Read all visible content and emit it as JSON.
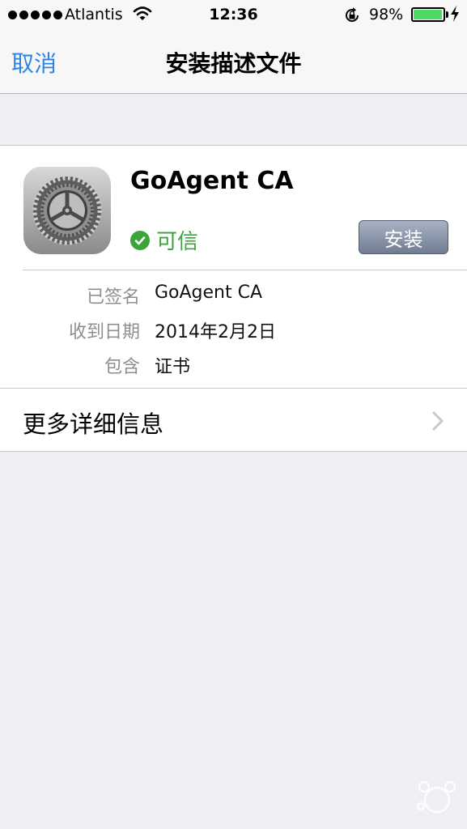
{
  "status_bar": {
    "carrier": "Atlantis",
    "time": "12:36",
    "battery_percent_label": "98%",
    "battery_level": 0.98,
    "icons": [
      "signal-dots-icon",
      "wifi-icon",
      "rotation-lock-icon",
      "battery-icon",
      "charging-bolt-icon"
    ]
  },
  "nav": {
    "back_label": "取消",
    "title": "安装描述文件"
  },
  "profile": {
    "name": "GoAgent CA",
    "trust_label": "可信",
    "install_label": "安装",
    "icon": "settings-gear-icon"
  },
  "details": [
    {
      "label": "已签名",
      "value": "GoAgent CA"
    },
    {
      "label": "收到日期",
      "value": "2014年2月2日"
    },
    {
      "label": "包含",
      "value": "证书"
    }
  ],
  "more": {
    "label": "更多详细信息"
  },
  "colors": {
    "accent_blue": "#2f82e6",
    "trusted_green": "#3aa53b",
    "background": "#efeff4",
    "battery_green": "#4cd964"
  }
}
